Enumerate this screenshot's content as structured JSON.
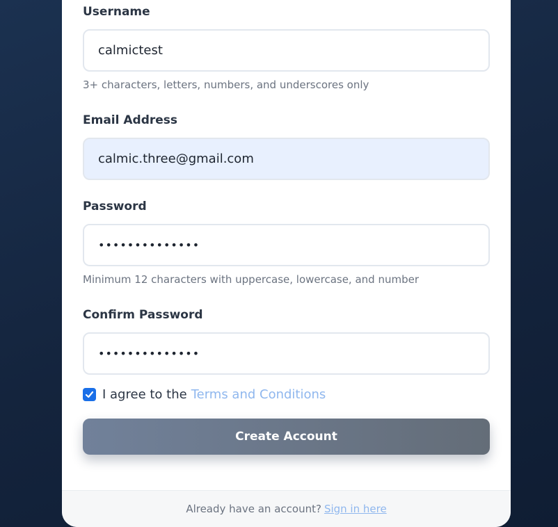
{
  "form": {
    "username": {
      "label": "Username",
      "value": "calmictest",
      "hint": "3+ characters, letters, numbers, and underscores only"
    },
    "email": {
      "label": "Email Address",
      "value": "calmic.three@gmail.com"
    },
    "password": {
      "label": "Password",
      "value": "••••••••••••••",
      "hint": "Minimum 12 characters with uppercase, lowercase, and number"
    },
    "confirm_password": {
      "label": "Confirm Password",
      "value": "••••••••••••••"
    },
    "agree": {
      "checked": true,
      "prefix": "I agree to the",
      "link": "Terms and Conditions"
    },
    "submit_label": "Create Account"
  },
  "footer": {
    "prompt": "Already have an account?",
    "link": "Sign in here"
  },
  "colors": {
    "accent": "#1a6fe8",
    "link": "#8fb7ee",
    "autofill": "#e8f0fe"
  }
}
